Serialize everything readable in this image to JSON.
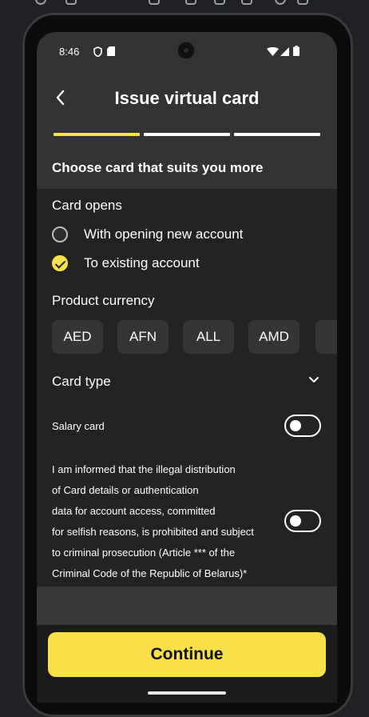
{
  "status_bar": {
    "time": "8:46"
  },
  "header": {
    "title": "Issue virtual card",
    "progress_segments": [
      "active",
      "inactive",
      "inactive"
    ]
  },
  "subtitle": "Choose card that suits you more",
  "card_opens": {
    "label": "Card opens",
    "options": [
      {
        "label": "With opening new account",
        "checked": false
      },
      {
        "label": "To existing account",
        "checked": true
      }
    ]
  },
  "currency": {
    "label": "Product currency",
    "options": [
      "AED",
      "AFN",
      "ALL",
      "AMD"
    ]
  },
  "card_type": {
    "label": "Card type"
  },
  "salary": {
    "label": "Salary card",
    "enabled": false
  },
  "legal": {
    "lines": [
      "I am informed that the illegal distribution",
      "of Card details or authentication",
      "data for account access, committed",
      "for selfish reasons, is prohibited and subject",
      "to criminal prosecution (Article *** of the",
      "Criminal Code of the Republic of Belarus)*"
    ],
    "accepted": false
  },
  "actions": {
    "continue_label": "Continue"
  },
  "colors": {
    "accent": "#f7e049",
    "background": "#232323",
    "header": "#333333"
  }
}
